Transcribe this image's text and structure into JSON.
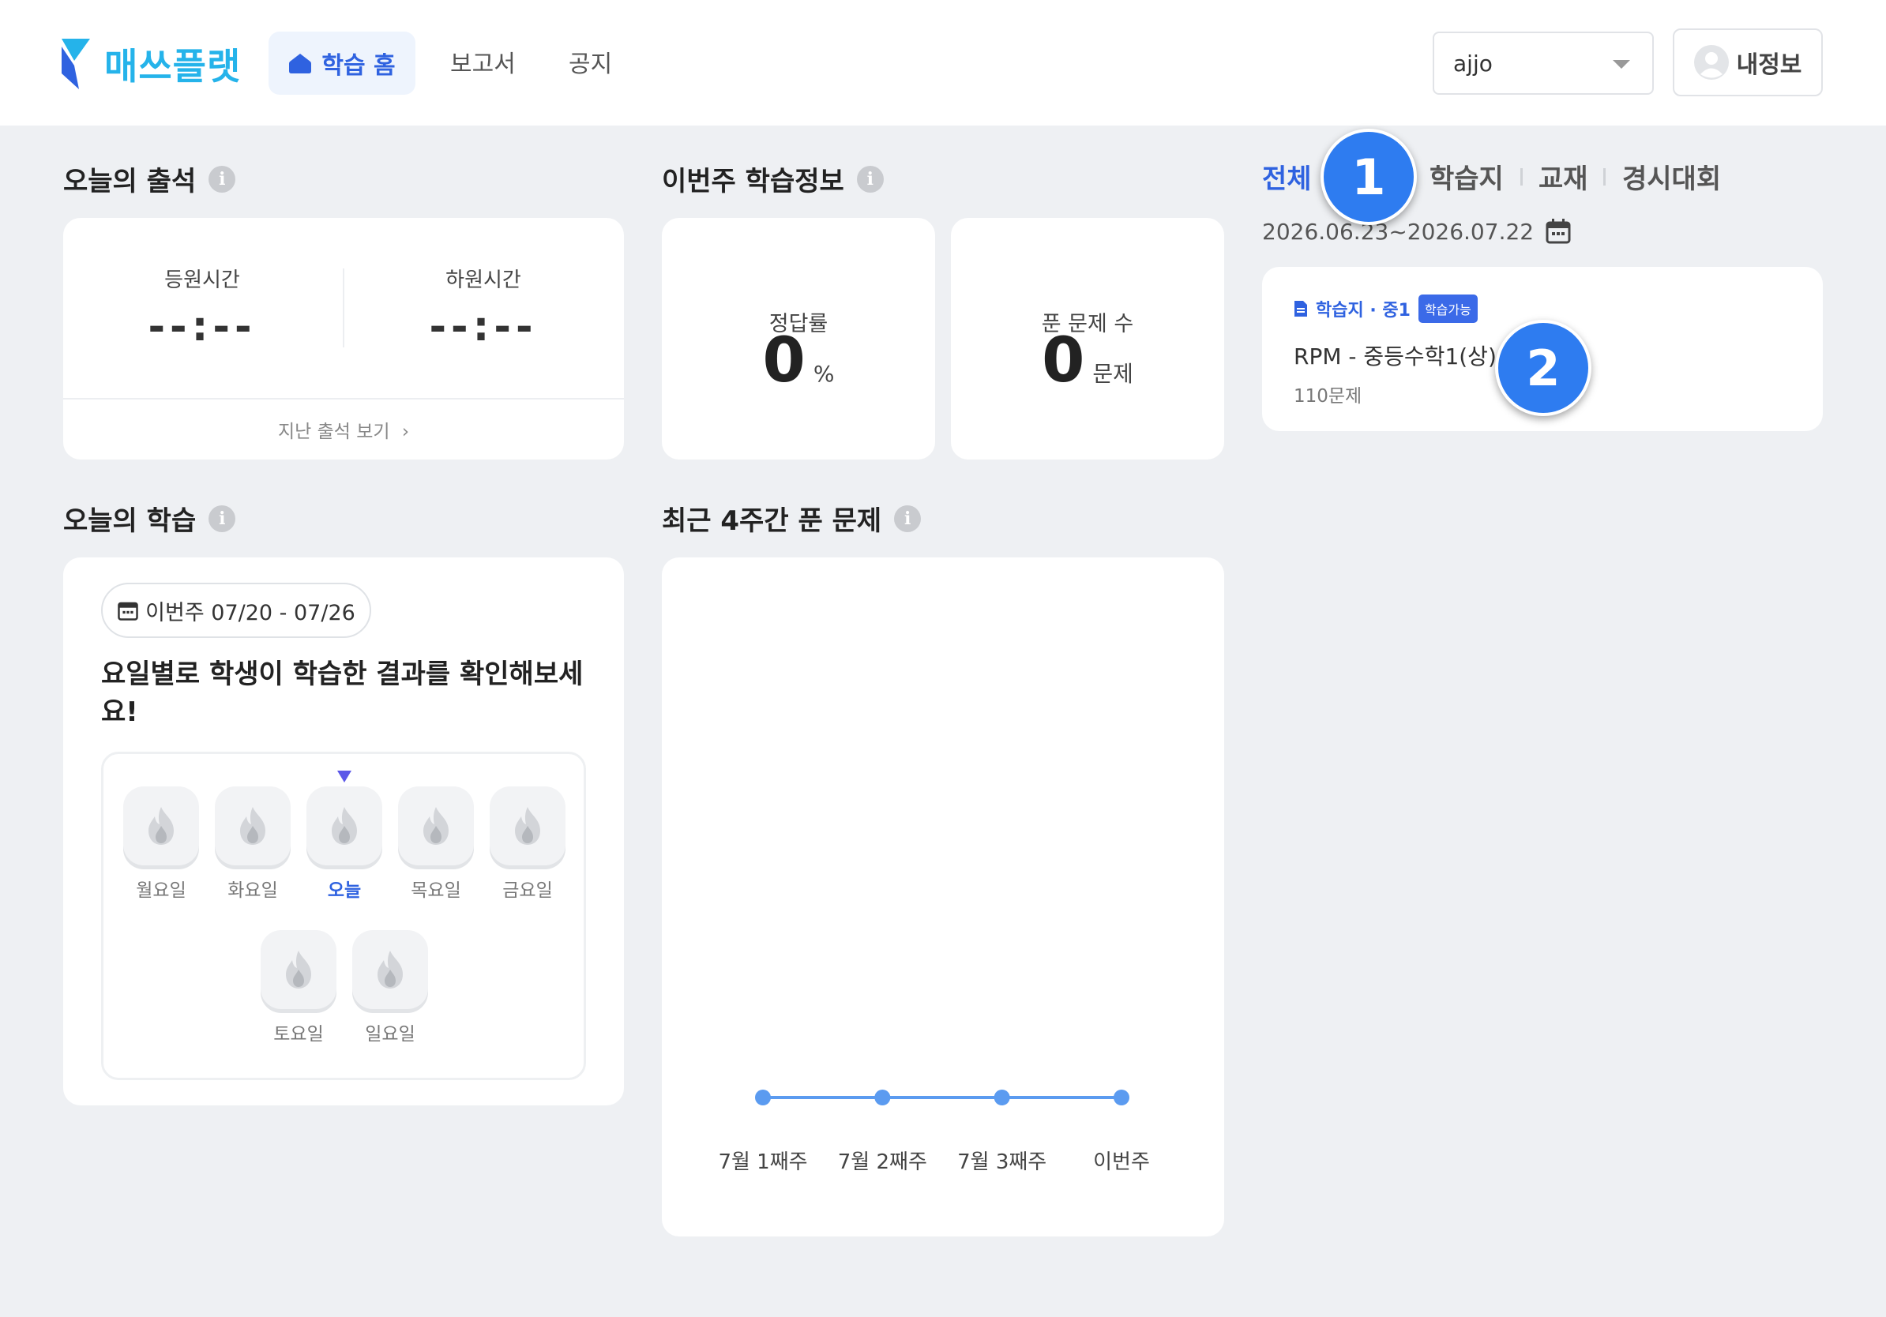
{
  "header": {
    "logo_text": "매쓰플랫",
    "nav": {
      "home": "학습 홈",
      "report": "보고서",
      "notice": "공지"
    },
    "user_select": {
      "value": "ajjo"
    },
    "my_info_label": "내정보"
  },
  "attendance": {
    "title": "오늘의 출석",
    "check_in_label": "등원시간",
    "check_in_value": "--:--",
    "check_out_label": "하원시간",
    "check_out_value": "--:--",
    "past_link": "지난 출석 보기"
  },
  "weekly_info": {
    "title": "이번주 학습정보",
    "accuracy_label": "정답률",
    "accuracy_value": "0",
    "accuracy_unit": "%",
    "solved_label": "푼 문제 수",
    "solved_value": "0",
    "solved_unit": "문제"
  },
  "filter": {
    "tabs": [
      "전체",
      "학습지",
      "교재",
      "경시대회"
    ],
    "active": "전체",
    "date_range": "2026.06.23~2026.07.22"
  },
  "worksheet": {
    "kind": "학습지 · 중1",
    "badge": "학습가능",
    "title": "RPM - 중등수학1(상) 9",
    "count": "110문제"
  },
  "step_badges": [
    "1",
    "2"
  ],
  "today_study": {
    "title": "오늘의 학습",
    "week_range": "이번주 07/20 - 07/26",
    "message": "요일별로 학생이 학습한 결과를 확인해보세요!",
    "days": [
      "월요일",
      "화요일",
      "오늘",
      "목요일",
      "금요일",
      "토요일",
      "일요일"
    ],
    "today_index": 2
  },
  "recent_chart": {
    "title": "최근 4주간 푼 문제"
  },
  "chart_data": {
    "type": "line",
    "categories": [
      "7월 1째주",
      "7월 2째주",
      "7월 3째주",
      "이번주"
    ],
    "values": [
      0,
      0,
      0,
      0
    ],
    "title": "최근 4주간 푼 문제",
    "xlabel": "",
    "ylabel": "",
    "color": "#5b9bf0",
    "grid": false
  },
  "colors": {
    "brand": "#25b3ea",
    "accent": "#2f62e0",
    "badge": "#3b6ae8",
    "step": "#2e7cf0"
  }
}
